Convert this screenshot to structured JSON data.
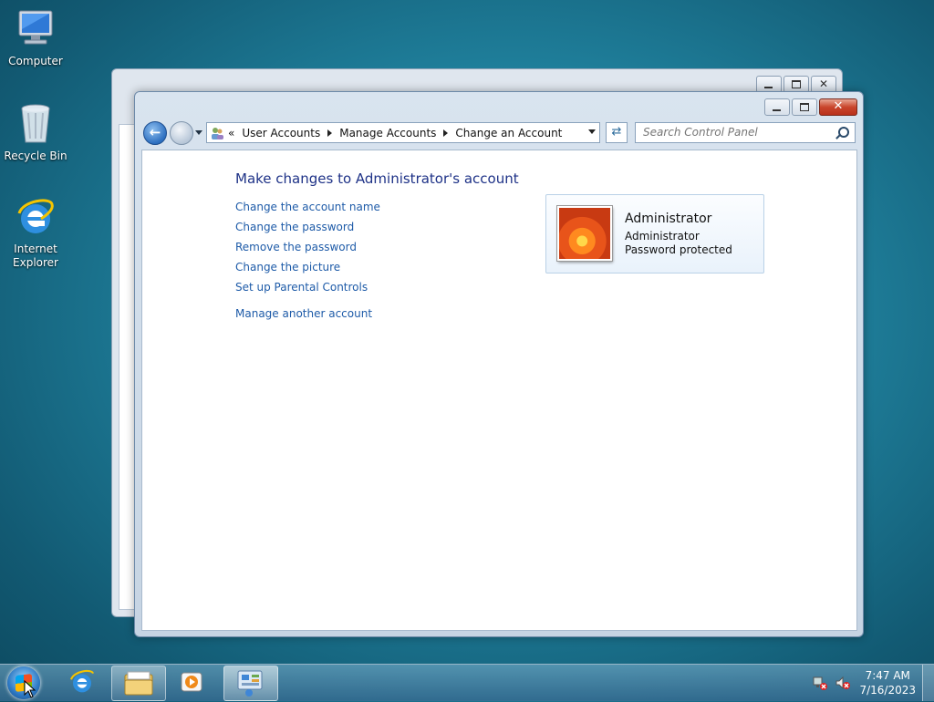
{
  "desktop": {
    "icons": [
      {
        "label_1": "Computer",
        "label_2": ""
      },
      {
        "label_1": "Recycle Bin",
        "label_2": ""
      },
      {
        "label_1": "Internet",
        "label_2": "Explorer"
      }
    ]
  },
  "window": {
    "breadcrumb": {
      "prefix": "«",
      "items": [
        "User Accounts",
        "Manage Accounts",
        "Change an Account"
      ]
    },
    "search": {
      "placeholder": "Search Control Panel"
    },
    "heading": "Make changes to Administrator's account",
    "links": [
      "Change the account name",
      "Change the password",
      "Remove the password",
      "Change the picture",
      "Set up Parental Controls",
      "Manage another account"
    ],
    "account": {
      "name": "Administrator",
      "type": "Administrator",
      "status": "Password protected"
    },
    "close_glyph": "✕"
  },
  "taskbar": {
    "time": "7:47 AM",
    "date": "7/16/2023"
  },
  "colors": {
    "link": "#1e5ba8",
    "heading": "#1e3287"
  }
}
